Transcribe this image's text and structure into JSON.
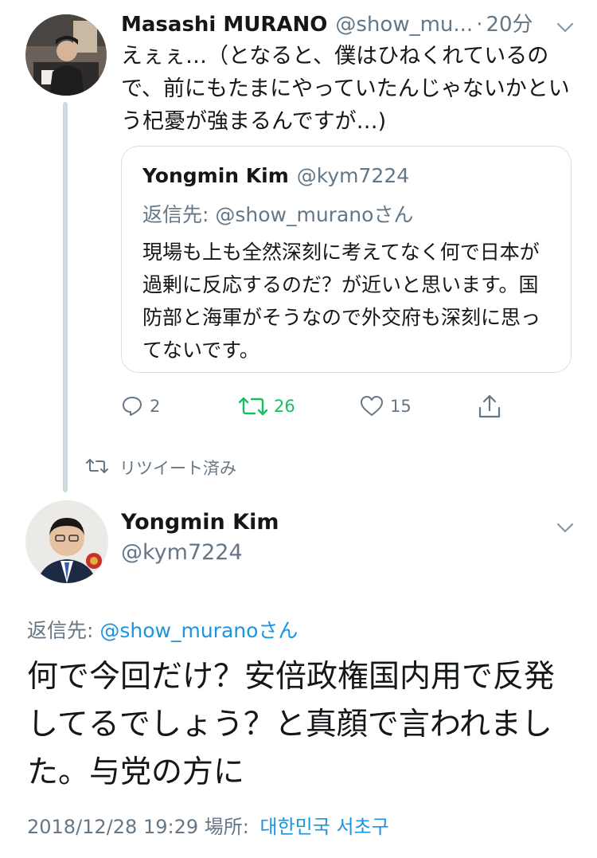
{
  "tweet1": {
    "author_name": "Masashi MURANO",
    "handle": "@show_mu...",
    "dot": "·",
    "time": "20分",
    "text": "えぇぇ…（となると、僕はひねくれているので、前にもたまにやっていたんじゃないかという杞憂が強まるんですが…)",
    "avatar_icon": "user-photo-avatar"
  },
  "quoted": {
    "author_name": "Yongmin Kim",
    "handle": "@kym7224",
    "reply_to": "返信先: @show_muranoさん",
    "text": "現場も上も全然深刻に考えてなく何で日本が過剰に反応するのだ？が近いと思います。国防部と海軍がそうなので外交府も深刻に思ってないです。"
  },
  "actions": {
    "reply_count": "2",
    "retweet_count": "26",
    "like_count": "15",
    "icons": [
      "reply-icon",
      "retweet-icon",
      "like-icon",
      "share-icon"
    ],
    "retweet_color": "#17bf63",
    "muted_color": "#657786"
  },
  "retweeted_label": "リツイート済み",
  "tweet2": {
    "author_name": "Yongmin Kim",
    "handle": "@kym7224",
    "reply_prefix": "返信先: ",
    "reply_mention": "@show_muranoさん",
    "text": "何で今回だけ？安倍政権国内用で反発してるでしょう？と真顔で言われました。与党の方に",
    "timestamp": "2018/12/28 19:29",
    "place_label": "場所:",
    "place": "대한민국 서초구",
    "link_color": "#1b95e0"
  }
}
